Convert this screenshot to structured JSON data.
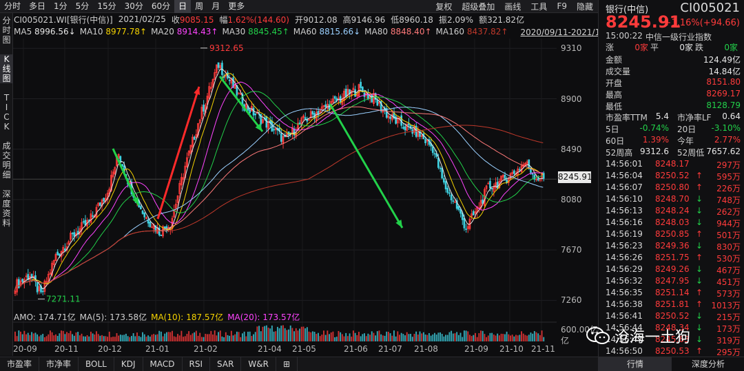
{
  "top_tabs": [
    "分时",
    "多日",
    "1分",
    "5分",
    "15分",
    "30分",
    "60分",
    "日",
    "周",
    "月",
    "更多"
  ],
  "top_active": "日",
  "top_right": [
    "复权",
    "超级叠加",
    "画线",
    "工具",
    "F9",
    "隐藏"
  ],
  "left_tabs": [
    "分时图",
    "K线图",
    "TICK",
    "成交明细",
    "深度资料"
  ],
  "quote": {
    "code_name": "CI005021.WI[银行(中信)]",
    "date": "2021/02/25",
    "close_label": "收",
    "close": "9085.15",
    "chg_label": "幅",
    "chg": "1.62%(144.60)",
    "open_label": "开",
    "open": "9012.08",
    "high_label": "高",
    "high": "9146.96",
    "low_label": "低",
    "low": "8960.18",
    "amp_label": "振",
    "amp": "2.09%",
    "amt_label": "额",
    "amt": "321.82亿"
  },
  "ma": [
    {
      "name": "MA5",
      "value": "8996.56↓",
      "color": "#e8e8e8"
    },
    {
      "name": "MA10",
      "value": "8977.78↑",
      "color": "#f5d300"
    },
    {
      "name": "MA20",
      "value": "8914.43↑",
      "color": "#ff44ff"
    },
    {
      "name": "MA30",
      "value": "8845.45↑",
      "color": "#22d14a"
    },
    {
      "name": "MA60",
      "value": "8815.66↓",
      "color": "#9ad0ff"
    },
    {
      "name": "MA80",
      "value": "8848.40↑",
      "color": "#ff7a7a"
    },
    {
      "name": "MA160",
      "value": "8437.82↑",
      "color": "#c0392b"
    }
  ],
  "range_text": "2020/09/11-2021/11/19(287日)",
  "chart_data": {
    "type": "candlestick",
    "yticks": [
      9310,
      8900,
      8490,
      8080,
      7670,
      7260
    ],
    "ylim": [
      7150,
      9390
    ],
    "xticks": [
      "20-09",
      "20-11",
      "20-12",
      "21-01",
      "21-02",
      "21-04",
      "21-05",
      "21-06",
      "21-07",
      "21-08",
      "21-09",
      "21-10",
      "21-11"
    ],
    "annotations": [
      {
        "text": "9312.65",
        "type": "high",
        "value": 9312.65
      },
      {
        "text": "7271.11",
        "type": "low",
        "value": 7271.11
      }
    ],
    "current_price": "8245.91",
    "close_keypoints": [
      [
        0,
        7380
      ],
      [
        8,
        7470
      ],
      [
        14,
        7300
      ],
      [
        22,
        7620
      ],
      [
        32,
        7800
      ],
      [
        40,
        7900
      ],
      [
        50,
        8150
      ],
      [
        56,
        8450
      ],
      [
        62,
        8200
      ],
      [
        70,
        7950
      ],
      [
        78,
        7820
      ],
      [
        84,
        7880
      ],
      [
        92,
        8350
      ],
      [
        100,
        8750
      ],
      [
        110,
        9180
      ],
      [
        116,
        9050
      ],
      [
        124,
        8850
      ],
      [
        132,
        8750
      ],
      [
        140,
        8650
      ],
      [
        146,
        8560
      ],
      [
        154,
        8700
      ],
      [
        162,
        8780
      ],
      [
        170,
        8850
      ],
      [
        178,
        8920
      ],
      [
        186,
        8980
      ],
      [
        194,
        8900
      ],
      [
        202,
        8760
      ],
      [
        210,
        8680
      ],
      [
        218,
        8620
      ],
      [
        226,
        8500
      ],
      [
        232,
        8200
      ],
      [
        238,
        8050
      ],
      [
        244,
        7850
      ],
      [
        250,
        8000
      ],
      [
        256,
        8180
      ],
      [
        262,
        8220
      ],
      [
        270,
        8300
      ],
      [
        276,
        8380
      ],
      [
        282,
        8260
      ],
      [
        287,
        8246
      ]
    ]
  },
  "amo": {
    "label": "AMO:",
    "value": "174.71亿",
    "ma5_label": "MA(5):",
    "ma5": "173.58亿",
    "ma10_label": "MA(10):",
    "ma10": "187.57亿",
    "ma20_label": "MA(20):",
    "ma20": "173.57亿",
    "axis_top": "600.00亿",
    "axis_unit": "亿"
  },
  "bottom_tabs": [
    "市盈率",
    "市净率",
    "BOLL",
    "KDJ",
    "MACD",
    "RSI",
    "SAR",
    "W&R",
    "⊞"
  ],
  "right_panel": {
    "title": "银行(中信)",
    "code": "CI005021",
    "price": "8245.91",
    "change": "+1.16%(+94.66)",
    "time": "15:00:22",
    "index_name": "中信一级行业指数",
    "updown": [
      {
        "k": "涨",
        "v": "0家"
      },
      {
        "k": "平",
        "v": "0家"
      },
      {
        "k": "跌",
        "v": "0家"
      }
    ],
    "stats": [
      {
        "k": "金额",
        "v": "124.49亿",
        "c": "#e8e8e8"
      },
      {
        "k": "成交量",
        "v": "14.84亿",
        "c": "#e8e8e8"
      },
      {
        "k": "开盘",
        "v": "8151.80",
        "c": "#ff3b3b"
      },
      {
        "k": "最高",
        "v": "8269.17",
        "c": "#ff3b3b"
      },
      {
        "k": "最低",
        "v": "8128.79",
        "c": "#22d14a"
      }
    ],
    "pe_pb": [
      {
        "k": "市盈率TTM",
        "v": "5.4",
        "k2": "市净率LF",
        "v2": "0.64"
      },
      {
        "k": "5日",
        "v": "-0.74%",
        "k2": "20日",
        "v2": "-3.10%"
      },
      {
        "k": "60日",
        "v": "1.39%",
        "k2": "今年",
        "v2": "2.77%"
      },
      {
        "k": "52周高",
        "v": "9312.6",
        "k2": "52周低",
        "v2": "7657.62"
      }
    ],
    "ticks": [
      {
        "t": "14:56:01",
        "p": "8248.17",
        "dir": "",
        "vol": "297万"
      },
      {
        "t": "14:56:04",
        "p": "8250.52",
        "dir": "up",
        "vol": "595万"
      },
      {
        "t": "14:56:07",
        "p": "8250.80",
        "dir": "up",
        "vol": "226万"
      },
      {
        "t": "14:56:10",
        "p": "8248.70",
        "dir": "down",
        "vol": "748万"
      },
      {
        "t": "14:56:13",
        "p": "8248.24",
        "dir": "down",
        "vol": "262万"
      },
      {
        "t": "14:56:16",
        "p": "8248.03",
        "dir": "down",
        "vol": "944万"
      },
      {
        "t": "14:56:19",
        "p": "8250.85",
        "dir": "up",
        "vol": "501万"
      },
      {
        "t": "14:56:23",
        "p": "8249.36",
        "dir": "down",
        "vol": "830万"
      },
      {
        "t": "14:56:26",
        "p": "8251.75",
        "dir": "up",
        "vol": "530万"
      },
      {
        "t": "14:56:29",
        "p": "8249.26",
        "dir": "down",
        "vol": "467万"
      },
      {
        "t": "14:56:32",
        "p": "8247.95",
        "dir": "down",
        "vol": "451万"
      },
      {
        "t": "14:56:35",
        "p": "8251.14",
        "dir": "up",
        "vol": "573万"
      },
      {
        "t": "14:56:38",
        "p": "8251.81",
        "dir": "up",
        "vol": "1013万"
      },
      {
        "t": "14:56:41",
        "p": "8250.52",
        "dir": "down",
        "vol": "215万"
      },
      {
        "t": "14:56:44",
        "p": "8248.34",
        "dir": "down",
        "vol": "173万"
      },
      {
        "t": "14:56:47",
        "p": "8245.63",
        "dir": "down",
        "vol": "319万"
      },
      {
        "t": "14:56:50",
        "p": "8250.53",
        "dir": "up",
        "vol": "295万"
      }
    ],
    "tabs": [
      "行情",
      "深度分析"
    ]
  },
  "watermark": "沧海一土狗",
  "colors": {
    "up": "#ff3b3b",
    "down": "#22d14a",
    "bg": "#0d0d0f"
  }
}
